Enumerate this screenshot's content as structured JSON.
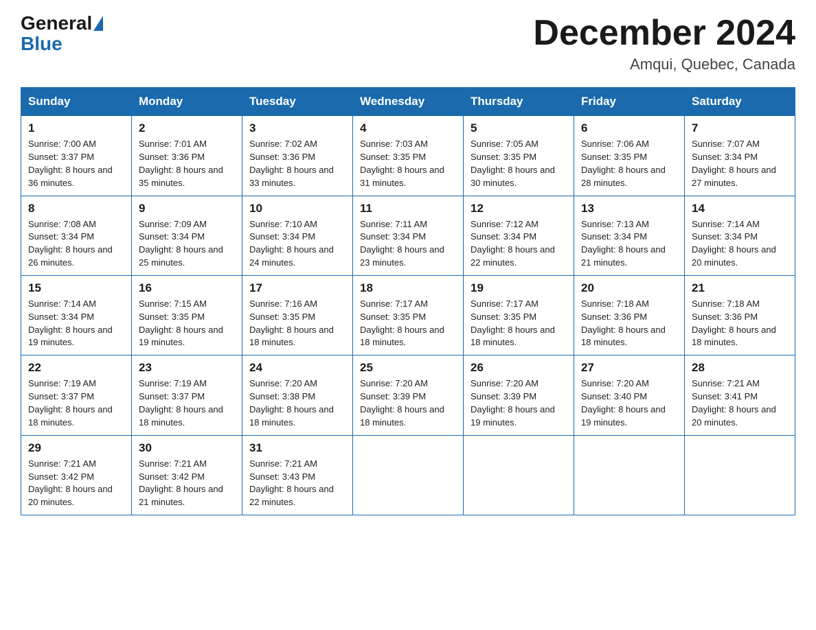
{
  "header": {
    "logo_general": "General",
    "logo_blue": "Blue",
    "title": "December 2024",
    "location": "Amqui, Quebec, Canada"
  },
  "days_of_week": [
    "Sunday",
    "Monday",
    "Tuesday",
    "Wednesday",
    "Thursday",
    "Friday",
    "Saturday"
  ],
  "weeks": [
    [
      {
        "num": "1",
        "sunrise": "7:00 AM",
        "sunset": "3:37 PM",
        "daylight": "8 hours and 36 minutes."
      },
      {
        "num": "2",
        "sunrise": "7:01 AM",
        "sunset": "3:36 PM",
        "daylight": "8 hours and 35 minutes."
      },
      {
        "num": "3",
        "sunrise": "7:02 AM",
        "sunset": "3:36 PM",
        "daylight": "8 hours and 33 minutes."
      },
      {
        "num": "4",
        "sunrise": "7:03 AM",
        "sunset": "3:35 PM",
        "daylight": "8 hours and 31 minutes."
      },
      {
        "num": "5",
        "sunrise": "7:05 AM",
        "sunset": "3:35 PM",
        "daylight": "8 hours and 30 minutes."
      },
      {
        "num": "6",
        "sunrise": "7:06 AM",
        "sunset": "3:35 PM",
        "daylight": "8 hours and 28 minutes."
      },
      {
        "num": "7",
        "sunrise": "7:07 AM",
        "sunset": "3:34 PM",
        "daylight": "8 hours and 27 minutes."
      }
    ],
    [
      {
        "num": "8",
        "sunrise": "7:08 AM",
        "sunset": "3:34 PM",
        "daylight": "8 hours and 26 minutes."
      },
      {
        "num": "9",
        "sunrise": "7:09 AM",
        "sunset": "3:34 PM",
        "daylight": "8 hours and 25 minutes."
      },
      {
        "num": "10",
        "sunrise": "7:10 AM",
        "sunset": "3:34 PM",
        "daylight": "8 hours and 24 minutes."
      },
      {
        "num": "11",
        "sunrise": "7:11 AM",
        "sunset": "3:34 PM",
        "daylight": "8 hours and 23 minutes."
      },
      {
        "num": "12",
        "sunrise": "7:12 AM",
        "sunset": "3:34 PM",
        "daylight": "8 hours and 22 minutes."
      },
      {
        "num": "13",
        "sunrise": "7:13 AM",
        "sunset": "3:34 PM",
        "daylight": "8 hours and 21 minutes."
      },
      {
        "num": "14",
        "sunrise": "7:14 AM",
        "sunset": "3:34 PM",
        "daylight": "8 hours and 20 minutes."
      }
    ],
    [
      {
        "num": "15",
        "sunrise": "7:14 AM",
        "sunset": "3:34 PM",
        "daylight": "8 hours and 19 minutes."
      },
      {
        "num": "16",
        "sunrise": "7:15 AM",
        "sunset": "3:35 PM",
        "daylight": "8 hours and 19 minutes."
      },
      {
        "num": "17",
        "sunrise": "7:16 AM",
        "sunset": "3:35 PM",
        "daylight": "8 hours and 18 minutes."
      },
      {
        "num": "18",
        "sunrise": "7:17 AM",
        "sunset": "3:35 PM",
        "daylight": "8 hours and 18 minutes."
      },
      {
        "num": "19",
        "sunrise": "7:17 AM",
        "sunset": "3:35 PM",
        "daylight": "8 hours and 18 minutes."
      },
      {
        "num": "20",
        "sunrise": "7:18 AM",
        "sunset": "3:36 PM",
        "daylight": "8 hours and 18 minutes."
      },
      {
        "num": "21",
        "sunrise": "7:18 AM",
        "sunset": "3:36 PM",
        "daylight": "8 hours and 18 minutes."
      }
    ],
    [
      {
        "num": "22",
        "sunrise": "7:19 AM",
        "sunset": "3:37 PM",
        "daylight": "8 hours and 18 minutes."
      },
      {
        "num": "23",
        "sunrise": "7:19 AM",
        "sunset": "3:37 PM",
        "daylight": "8 hours and 18 minutes."
      },
      {
        "num": "24",
        "sunrise": "7:20 AM",
        "sunset": "3:38 PM",
        "daylight": "8 hours and 18 minutes."
      },
      {
        "num": "25",
        "sunrise": "7:20 AM",
        "sunset": "3:39 PM",
        "daylight": "8 hours and 18 minutes."
      },
      {
        "num": "26",
        "sunrise": "7:20 AM",
        "sunset": "3:39 PM",
        "daylight": "8 hours and 19 minutes."
      },
      {
        "num": "27",
        "sunrise": "7:20 AM",
        "sunset": "3:40 PM",
        "daylight": "8 hours and 19 minutes."
      },
      {
        "num": "28",
        "sunrise": "7:21 AM",
        "sunset": "3:41 PM",
        "daylight": "8 hours and 20 minutes."
      }
    ],
    [
      {
        "num": "29",
        "sunrise": "7:21 AM",
        "sunset": "3:42 PM",
        "daylight": "8 hours and 20 minutes."
      },
      {
        "num": "30",
        "sunrise": "7:21 AM",
        "sunset": "3:42 PM",
        "daylight": "8 hours and 21 minutes."
      },
      {
        "num": "31",
        "sunrise": "7:21 AM",
        "sunset": "3:43 PM",
        "daylight": "8 hours and 22 minutes."
      },
      null,
      null,
      null,
      null
    ]
  ]
}
